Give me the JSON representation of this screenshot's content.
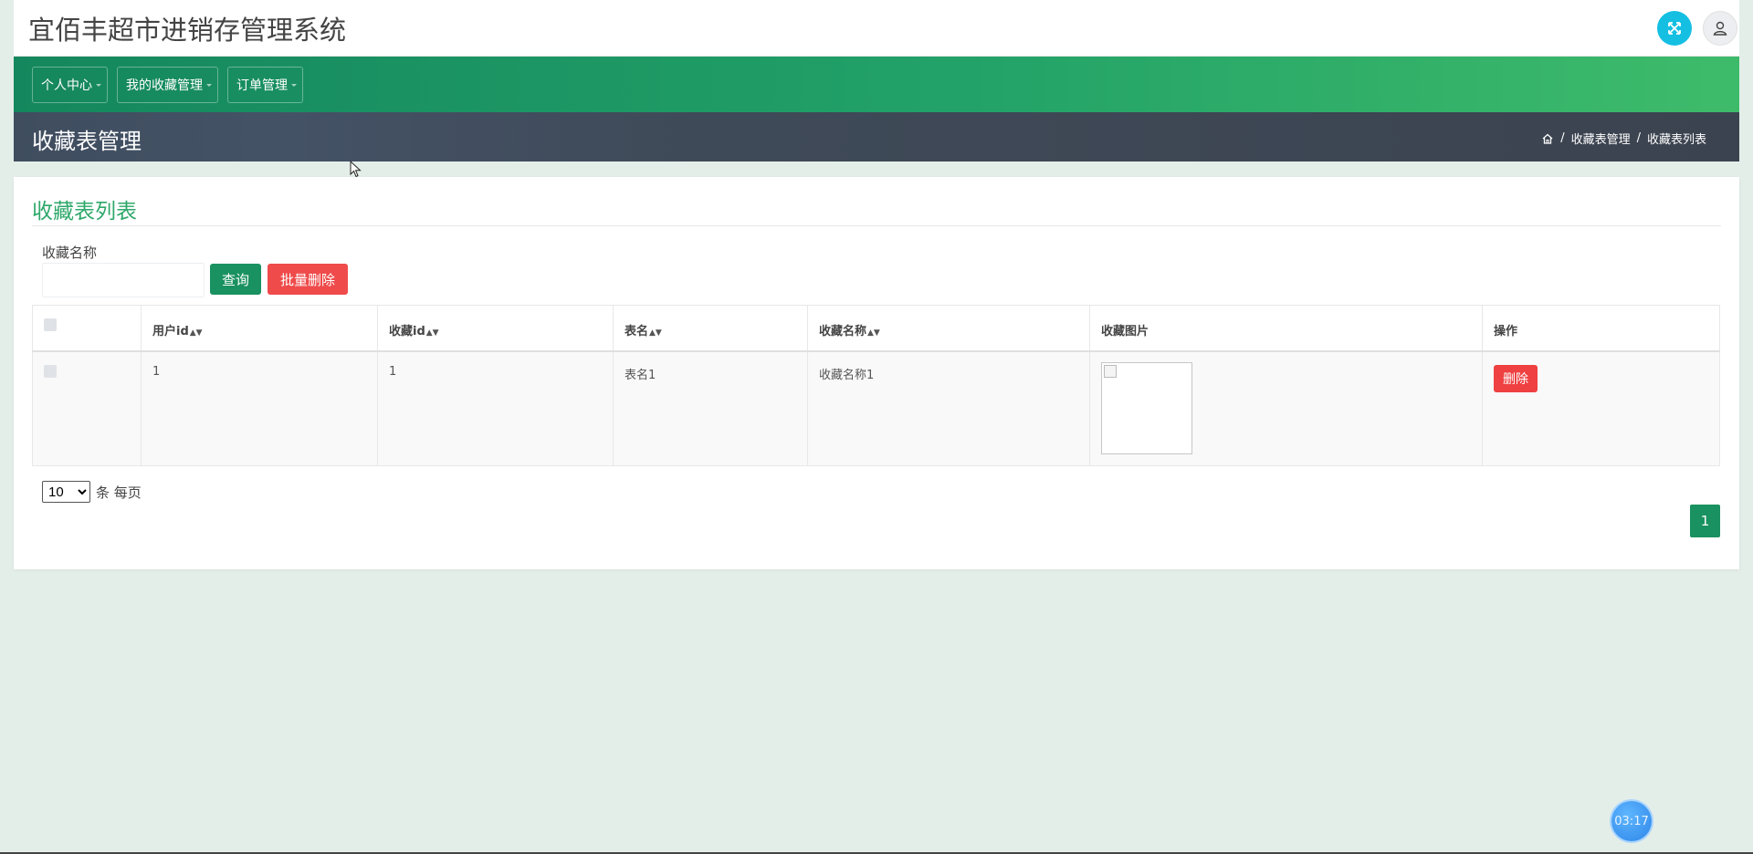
{
  "header": {
    "title": "宜佰丰超市进销存管理系统",
    "expand_icon": "expand-icon",
    "user_icon": "user-icon"
  },
  "nav": {
    "items": [
      {
        "label": "个人中心"
      },
      {
        "label": "我的收藏管理"
      },
      {
        "label": "订单管理"
      }
    ]
  },
  "pagebar": {
    "title": "收藏表管理",
    "breadcrumb": {
      "home_icon": "home-icon",
      "separator": "/",
      "level1": "收藏表管理",
      "level2": "收藏表列表"
    }
  },
  "card": {
    "title": "收藏表列表",
    "search": {
      "label": "收藏名称",
      "value": "",
      "placeholder": ""
    },
    "buttons": {
      "query": "查询",
      "batch_delete": "批量删除"
    },
    "table": {
      "columns": [
        "用户id",
        "收藏id",
        "表名",
        "收藏名称",
        "收藏图片",
        "操作"
      ],
      "sortable": [
        true,
        true,
        true,
        true,
        false,
        false
      ],
      "rows": [
        {
          "user_id": "1",
          "fav_id": "1",
          "table_name": "表名1",
          "fav_name": "收藏名称1",
          "action": "删除"
        }
      ]
    },
    "pagination": {
      "page_size": "10",
      "page_size_options": [
        "10"
      ],
      "per_page_text": "条 每页",
      "current_page": "1"
    }
  },
  "timer": {
    "value": "03:17"
  },
  "colors": {
    "nav_green": "#22a268",
    "primary": "#1a9160",
    "danger": "#ef4b4b",
    "title_green": "#2ea86a",
    "pagebar": "#3f4a58",
    "accent_cyan": "#14bfe2"
  }
}
